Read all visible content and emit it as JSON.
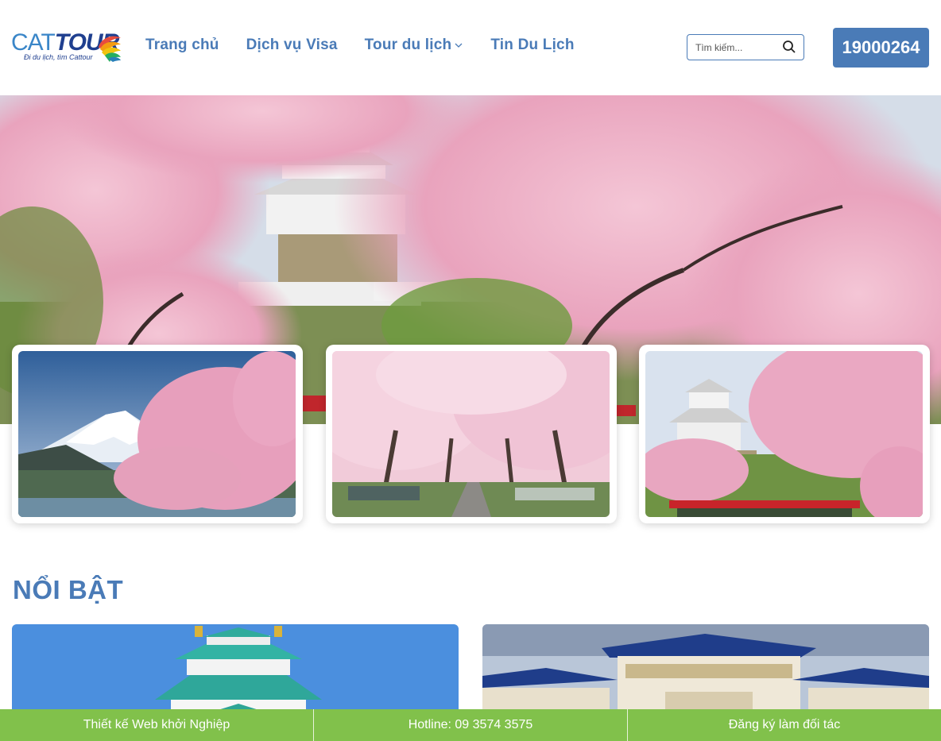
{
  "brand": {
    "logo_cat": "CAT",
    "logo_tour": "TOUR",
    "tagline": "Đi du lịch, tìm Cattour"
  },
  "nav": {
    "items": [
      {
        "label": "Trang chủ"
      },
      {
        "label": "Dịch vụ Visa"
      },
      {
        "label": "Tour du lịch",
        "has_dropdown": true
      },
      {
        "label": "Tin Du Lịch"
      }
    ]
  },
  "search": {
    "placeholder": "Tìm kiếm..."
  },
  "phone_button": {
    "label": "19000264"
  },
  "hero": {
    "image": "cherry-blossom-castle-photo"
  },
  "cards": [
    {
      "image": "mount-fuji-cherry-blossom-photo"
    },
    {
      "image": "cherry-blossom-park-picnic-photo"
    },
    {
      "image": "himeji-castle-cherry-blossom-photo"
    }
  ],
  "featured": {
    "title": "NỔI BẬT",
    "items": [
      {
        "image": "nagoya-castle-photo"
      },
      {
        "image": "asian-gate-pagoda-photo"
      }
    ]
  },
  "bottom_bar": {
    "items": [
      {
        "label": "Thiết kế Web khởi Nghiệp"
      },
      {
        "label": "Hotline: 09 3574 3575"
      },
      {
        "label": "Đăng ký làm đối tác"
      }
    ]
  },
  "colors": {
    "primary": "#4a7bb7",
    "bottom_bar": "#81c14b"
  }
}
